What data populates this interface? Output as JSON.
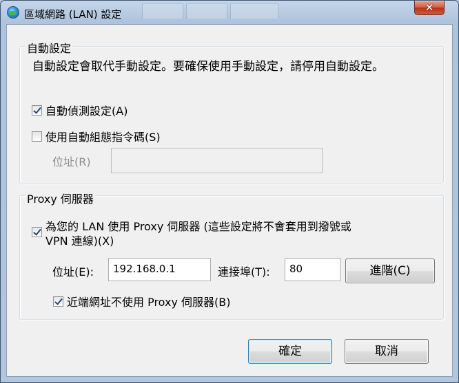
{
  "window": {
    "title": "區域網路 (LAN) 設定",
    "close_glyph": "✕"
  },
  "auto_config": {
    "group_title": "自動設定",
    "description": "自動設定會取代手動設定。要確保使用手動設定，請停用自動設定。",
    "auto_detect": {
      "label": "自動偵測設定(A)",
      "checked": true
    },
    "use_script": {
      "label": "使用自動組態指令碼(S)",
      "checked": false
    },
    "address_label": "位址(R)",
    "address_value": ""
  },
  "proxy": {
    "group_title": "Proxy 伺服器",
    "use_proxy": {
      "label_line1": "為您的 LAN 使用 Proxy 伺服器 (這些設定將不會套用到撥號或",
      "label_line2": "VPN 連線)(X)",
      "checked": true
    },
    "address_label": "位址(E):",
    "address_value": "192.168.0.1",
    "port_label": "連接埠(T):",
    "port_value": "80",
    "advanced_label": "進階(C)",
    "bypass_local": {
      "label": "近端網址不使用 Proxy 伺服器(B)",
      "checked": true
    }
  },
  "buttons": {
    "ok": "確定",
    "cancel": "取消"
  }
}
